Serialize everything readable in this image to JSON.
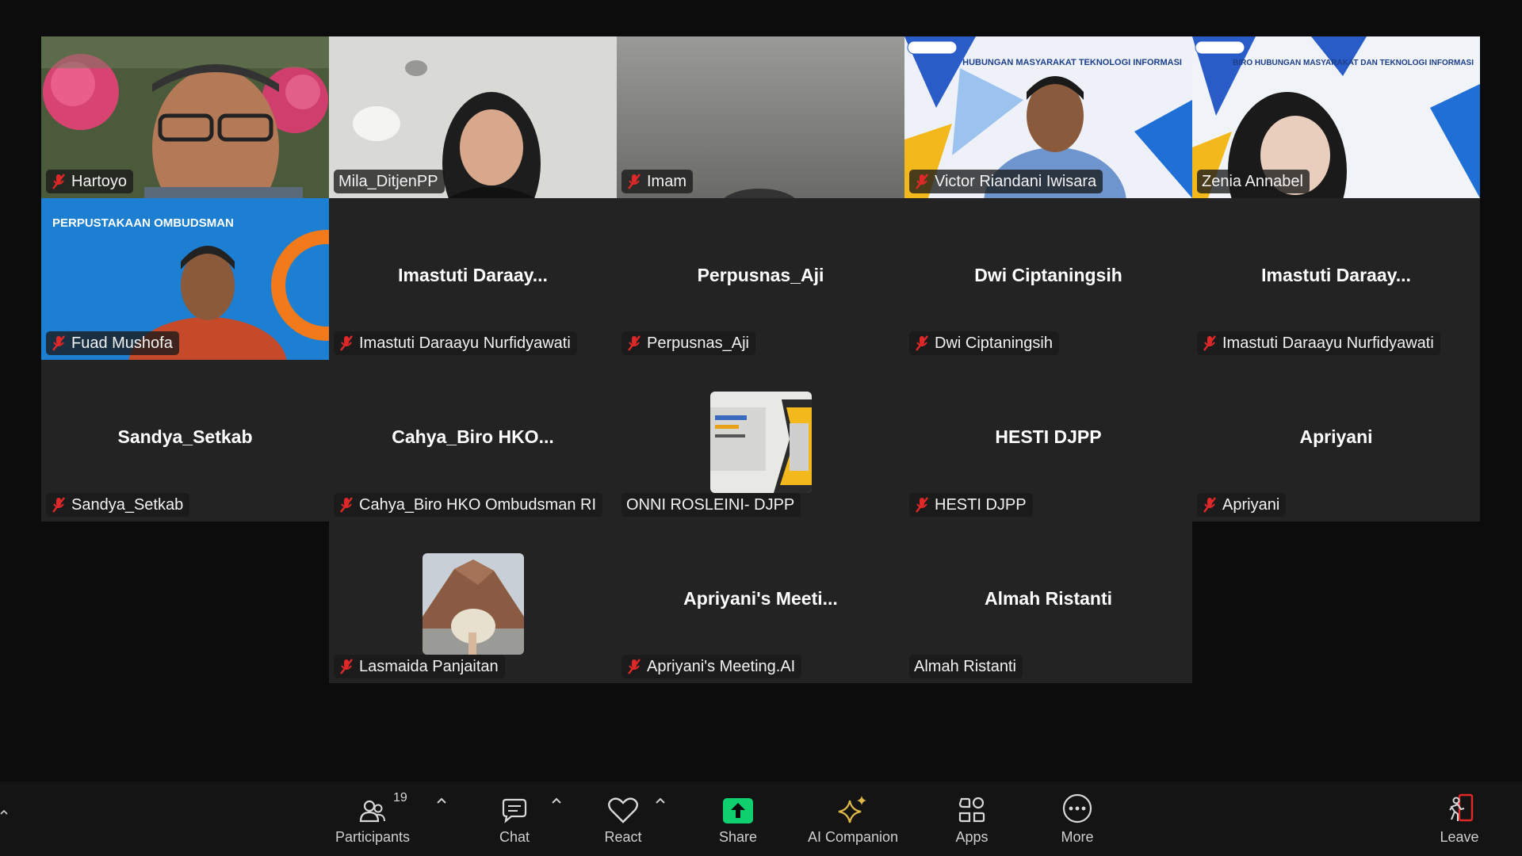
{
  "tiles": [
    {
      "name": "Hartoyo",
      "muted": true,
      "video": "hartoyo"
    },
    {
      "name": "Mila_DitjenPP",
      "muted": false,
      "video": "mila",
      "active": true
    },
    {
      "name": "Imam",
      "muted": true,
      "video": "imam"
    },
    {
      "name": "Victor Riandani Iwisara",
      "muted": true,
      "video": "victor",
      "banner": "HUBUNGAN MASYARAKAT TEKNOLOGI INFORMASI"
    },
    {
      "name": "Zenia Annabel",
      "muted": false,
      "video": "zenia",
      "banner": "BIRO HUBUNGAN MASYARAKAT DAN TEKNOLOGI INFORMASI"
    },
    {
      "name": "Fuad Mushofa",
      "muted": true,
      "video": "fuad",
      "banner": "PERPUSTAKAAN OMBUDSMAN"
    },
    {
      "name": "Imastuti Daraayu Nurfidyawati",
      "muted": true,
      "display": "Imastuti  Daraay..."
    },
    {
      "name": "Perpusnas_Aji",
      "muted": true,
      "display": "Perpusnas_Aji"
    },
    {
      "name": "Dwi Ciptaningsih",
      "muted": true,
      "display": "Dwi Ciptaningsih"
    },
    {
      "name": "Imastuti Daraayu Nurfidyawati",
      "muted": true,
      "display": "Imastuti  Daraay..."
    },
    {
      "name": "Sandya_Setkab",
      "muted": true,
      "display": "Sandya_Setkab"
    },
    {
      "name": "Cahya_Biro HKO Ombudsman RI",
      "muted": true,
      "display": "Cahya_Biro  HKO..."
    },
    {
      "name": "ONNI ROSLEINI- DJPP",
      "muted": false,
      "avatar": "building"
    },
    {
      "name": "HESTI DJPP",
      "muted": true,
      "display": "HESTI DJPP"
    },
    {
      "name": "Apriyani",
      "muted": true,
      "display": "Apriyani"
    },
    {
      "name": "Lasmaida Panjaitan",
      "muted": true,
      "avatar": "mountain"
    },
    {
      "name": "Apriyani's Meeting.AI",
      "muted": true,
      "display": "Apriyani's  Meeti..."
    },
    {
      "name": "Almah Ristanti",
      "muted": false,
      "display": "Almah Ristanti"
    }
  ],
  "toolbar": {
    "participants": {
      "label": "Participants",
      "count": "19",
      "icon": "participants-icon"
    },
    "chat": {
      "label": "Chat",
      "icon": "chat-icon"
    },
    "react": {
      "label": "React",
      "icon": "heart-icon"
    },
    "share": {
      "label": "Share",
      "icon": "share-arrow-icon"
    },
    "ai": {
      "label": "AI Companion",
      "icon": "sparkle-icon"
    },
    "apps": {
      "label": "Apps",
      "icon": "apps-icon"
    },
    "more": {
      "label": "More",
      "icon": "more-dots-icon"
    },
    "leave": {
      "label": "Leave",
      "icon": "leave-icon"
    }
  },
  "colors": {
    "active_speaker": "#23d96e",
    "muted": "#e02828",
    "share": "#0ed06e",
    "ai": "#e0b84a",
    "leave": "#e02828"
  }
}
